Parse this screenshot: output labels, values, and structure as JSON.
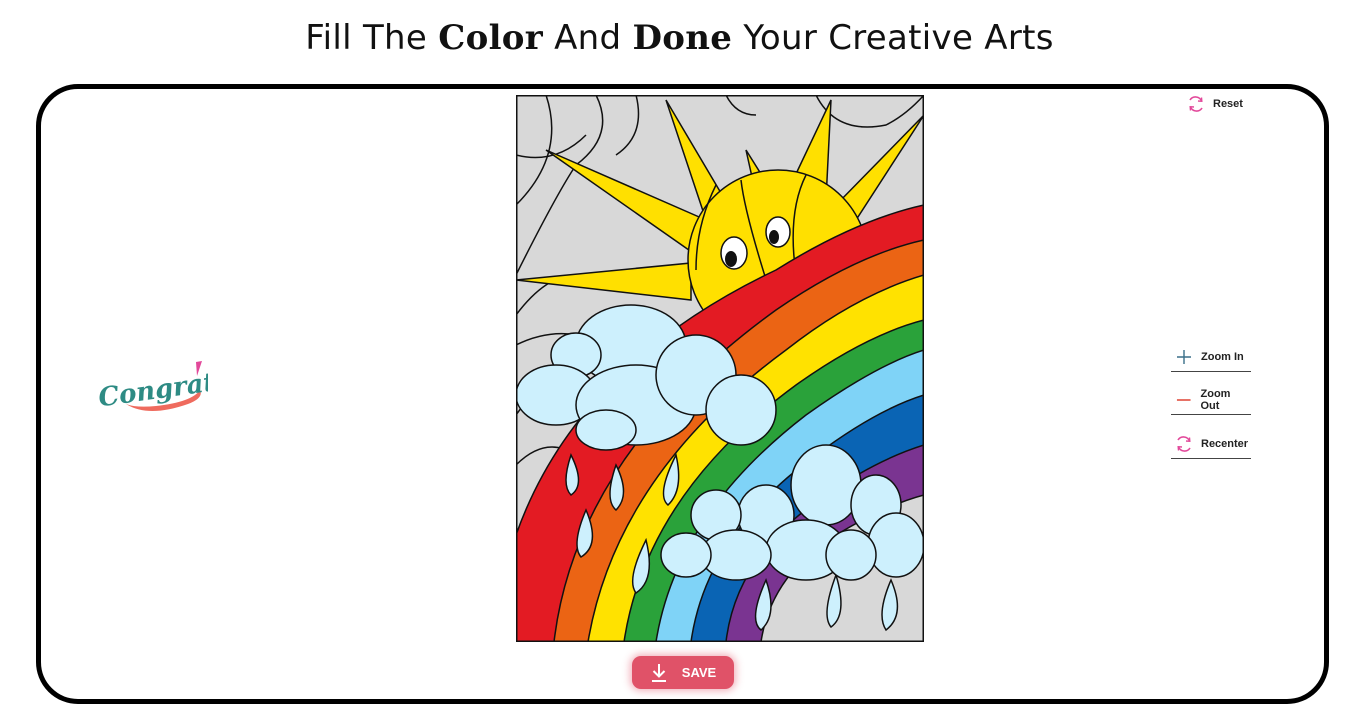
{
  "header": {
    "part1": "Fill The ",
    "bold1": "Color",
    "part2": " And ",
    "bold2": "Done",
    "part3": " Your Creative Arts"
  },
  "toolbar": {
    "reset_label": "Reset",
    "zoom_in_label": "Zoom In",
    "zoom_out_label": "Zoom Out",
    "recenter_label": "Recenter",
    "save_label": "SAVE"
  },
  "sticker": {
    "text": "Congrats!"
  },
  "colors": {
    "accent": "#e05268",
    "refresh_icon": "#e2489a",
    "zoom_in_icon": "#3a6f88",
    "zoom_out_icon": "#e04a3a",
    "rainbow": [
      "#e31b23",
      "#eb6414",
      "#ffe200",
      "#2aa23a",
      "#7fd3f7",
      "#0a64b4",
      "#7a3491"
    ],
    "sky": "#d8d8d8",
    "sun": "#ffe000",
    "cloud": "#cdf0fd"
  },
  "icons": {
    "reset": "refresh-icon",
    "zoom_in": "plus-icon",
    "zoom_out": "minus-icon",
    "recenter": "refresh-icon",
    "save": "download-icon"
  }
}
